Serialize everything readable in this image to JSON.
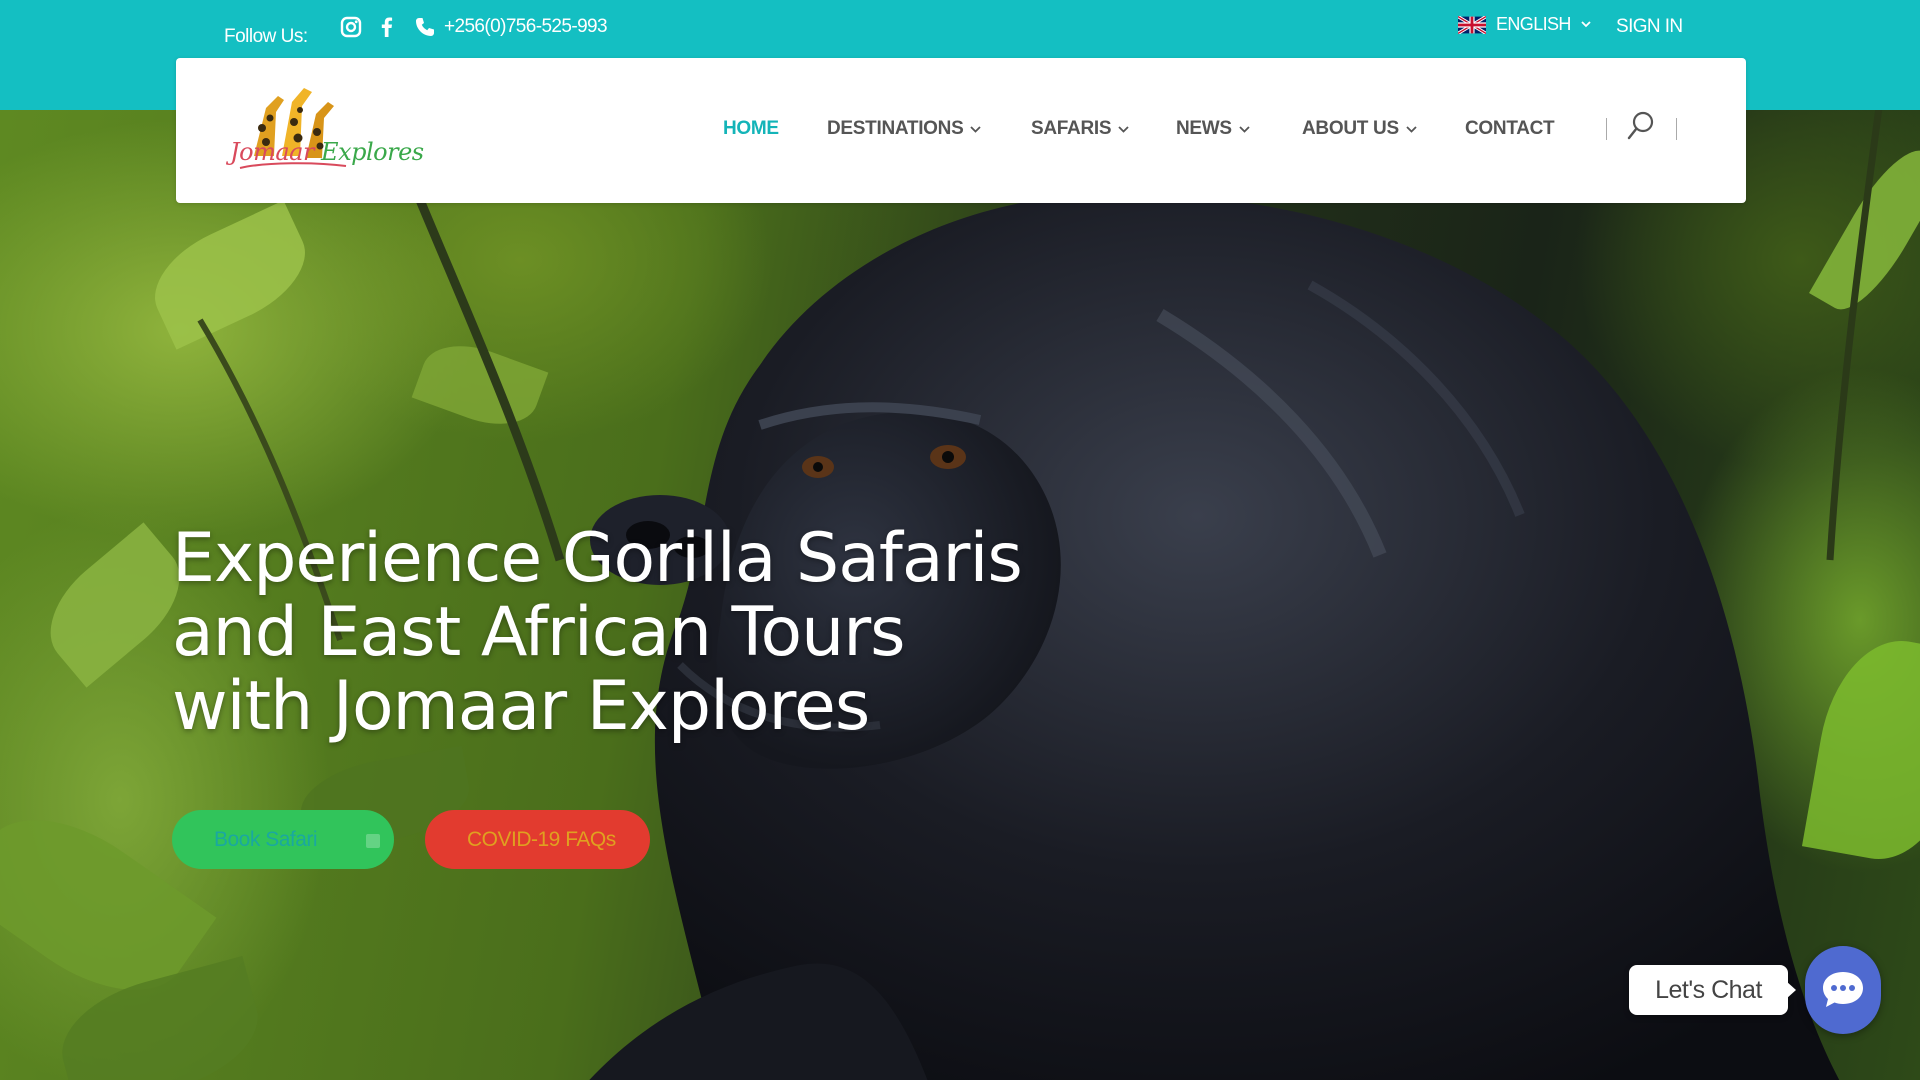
{
  "topbar": {
    "follow_label": "Follow Us:",
    "social_icons": [
      "instagram-icon",
      "facebook-icon"
    ],
    "phone": "+256(0)756-525-993",
    "language": "ENGLISH",
    "signin_label": "SIGN IN",
    "color": "#14bfc2"
  },
  "header": {
    "logo_text_first": "Jomaar",
    "logo_text_second": " Explores",
    "nav": [
      {
        "label": "HOME",
        "active": true,
        "dropdown": false
      },
      {
        "label": "DESTINATIONS",
        "active": false,
        "dropdown": true
      },
      {
        "label": "SAFARIS",
        "active": false,
        "dropdown": true
      },
      {
        "label": "NEWS",
        "active": false,
        "dropdown": true
      },
      {
        "label": "ABOUT US",
        "active": false,
        "dropdown": true
      },
      {
        "label": "CONTACT",
        "active": false,
        "dropdown": false
      }
    ],
    "active_color": "#14b4b8"
  },
  "hero": {
    "title_line1": "Experience Gorilla Safaris",
    "title_line2": "and East African Tours",
    "title_line3": "with Jomaar Explores",
    "book_button": "Book Safari",
    "covid_button": "COVID-19 FAQs"
  },
  "chat": {
    "label": "Let's Chat",
    "color": "#4f6ad0"
  }
}
